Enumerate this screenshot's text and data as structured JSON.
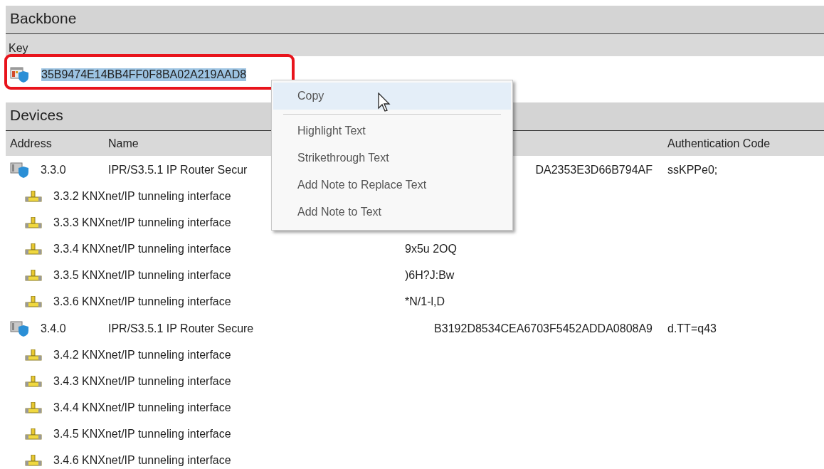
{
  "backbone": {
    "title": "Backbone",
    "columns": [
      "Key"
    ],
    "key": {
      "text": "35B9474E14BB4FF0F8BA02A219AAD8",
      "selected": true
    }
  },
  "devices": {
    "title": "Devices",
    "columns": [
      "Address",
      "Name",
      "Authentication Code"
    ],
    "rows": [
      {
        "address": "3.3.0",
        "name": "IPR/S3.5.1 IP Router Secur",
        "column_3": "DA2353E3D66B794AF",
        "auth_code": "ssKPPe0;",
        "children": [
          {
            "label": "3.3.2 KNXnet/IP tunneling interface"
          },
          {
            "label": "3.3.3 KNXnet/IP tunneling interface"
          },
          {
            "label": "3.3.4 KNXnet/IP tunneling interface",
            "column_3": "9x5u 2OQ"
          },
          {
            "label": "3.3.5 KNXnet/IP tunneling interface",
            "column_3": ")6H?J:Bw"
          },
          {
            "label": "3.3.6 KNXnet/IP tunneling interface",
            "column_3": "*N/1-l,D"
          }
        ]
      },
      {
        "address": "3.4.0",
        "name": "IPR/S3.5.1 IP Router Secure",
        "column_3": "B3192D8534CEA6703F5452ADDA0808A9",
        "auth_code": "d.TT=q43",
        "children": [
          {
            "label": "3.4.2 KNXnet/IP tunneling interface"
          },
          {
            "label": "3.4.3 KNXnet/IP tunneling interface"
          },
          {
            "label": "3.4.4 KNXnet/IP tunneling interface"
          },
          {
            "label": "3.4.5 KNXnet/IP tunneling interface"
          },
          {
            "label": "3.4.6 KNXnet/IP tunneling interface"
          }
        ]
      }
    ]
  },
  "context_menu": {
    "items": [
      {
        "kind": "item",
        "label": "Copy",
        "selected": true
      },
      {
        "kind": "separator"
      },
      {
        "kind": "item",
        "label": "Highlight Text",
        "selected": false
      },
      {
        "kind": "item",
        "label": "Strikethrough Text",
        "selected": false
      },
      {
        "kind": "item",
        "label": "Add Note to Replace Text",
        "selected": false
      },
      {
        "kind": "item",
        "label": "Add Note to Text",
        "selected": false
      }
    ]
  }
}
